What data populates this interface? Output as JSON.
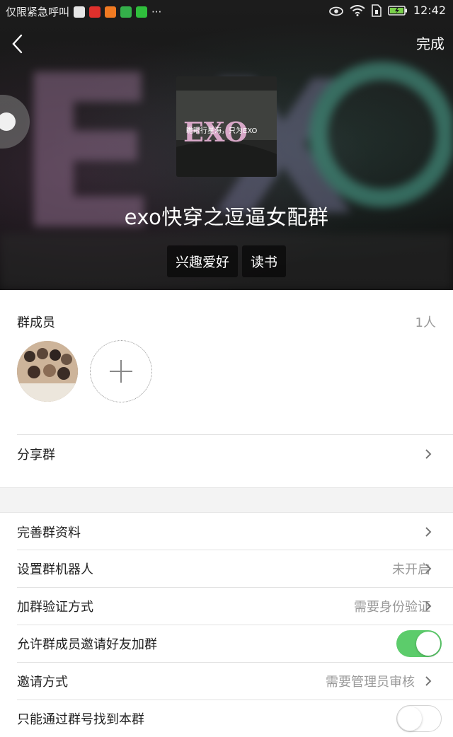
{
  "status_bar": {
    "carrier_text": "仅限紧急呼叫",
    "more": "···",
    "time": "12:42",
    "app_icons": [
      "weibo-icon",
      "weibo-icon",
      "orange-app-icon",
      "video-app-icon",
      "iqiyi-icon"
    ]
  },
  "header": {
    "done_label": "完成",
    "group_avatar_text": "瞻眼行星海，只为EXO",
    "group_avatar_logo": "EXO",
    "group_name": "exo快穿之逗逼女配群",
    "tags": [
      "兴趣爱好",
      "读书"
    ]
  },
  "members": {
    "title": "群成员",
    "count": "1人"
  },
  "share": {
    "label": "分享群"
  },
  "settings": [
    {
      "label": "完善群资料",
      "value": ""
    },
    {
      "label": "设置群机器人",
      "value": "未开启"
    },
    {
      "label": "加群验证方式",
      "value": "需要身份验证"
    },
    {
      "label": "允许群成员邀请好友加群",
      "toggle": true
    },
    {
      "label": "邀请方式",
      "value": "需要管理员审核"
    },
    {
      "label": "只能通过群号找到本群",
      "toggle": false
    }
  ],
  "colors": {
    "accent_green": "#5ccc6b",
    "text_primary": "#222222",
    "text_secondary": "#999999"
  }
}
